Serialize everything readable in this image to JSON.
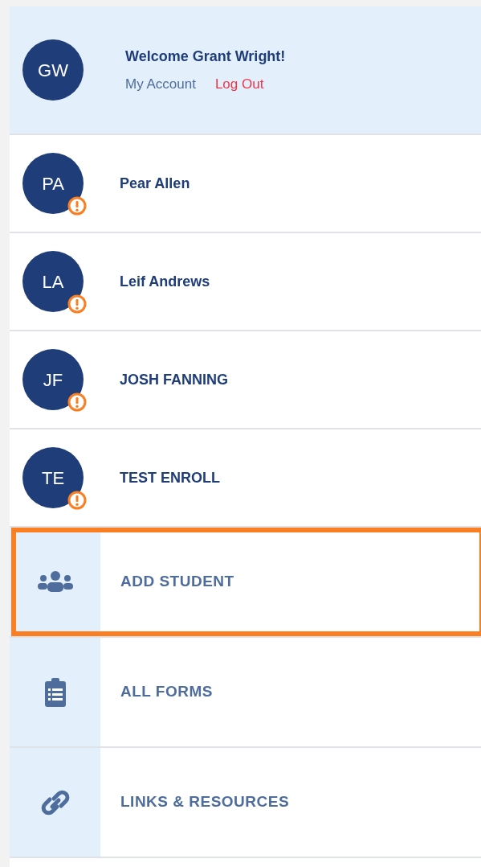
{
  "account": {
    "initials": "GW",
    "welcome": "Welcome Grant Wright!",
    "links": [
      {
        "kind": "account",
        "label": "My Account"
      },
      {
        "kind": "logout",
        "label": "Log Out"
      }
    ]
  },
  "students": [
    {
      "initials": "PA",
      "name": "Pear Allen",
      "alert": true
    },
    {
      "initials": "LA",
      "name": "Leif Andrews",
      "alert": true
    },
    {
      "initials": "JF",
      "name": "JOSH FANNING",
      "alert": true
    },
    {
      "initials": "TE",
      "name": "TEST ENROLL",
      "alert": true
    }
  ],
  "menu": [
    {
      "kind": "people",
      "label": "ADD STUDENT",
      "highlighted": true
    },
    {
      "kind": "clipboard",
      "label": "ALL FORMS",
      "highlighted": false
    },
    {
      "kind": "link",
      "label": "LINKS & RESOURCES",
      "highlighted": false
    }
  ]
}
